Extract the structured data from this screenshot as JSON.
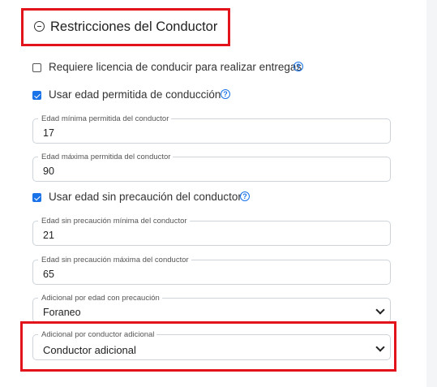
{
  "section": {
    "title": "Restricciones del Conductor"
  },
  "checkboxes": [
    {
      "label": "Requiere licencia de conducir para realizar entregas",
      "checked": false
    },
    {
      "label": "Usar edad permitida de conducción",
      "checked": true
    },
    {
      "label": "Usar edad sin precaución del conductor",
      "checked": true
    }
  ],
  "fields": {
    "min_age": {
      "label": "Edad mínima permitida del conductor",
      "value": "17"
    },
    "max_age": {
      "label": "Edad máxima permitida del conductor",
      "value": "90"
    },
    "min_caution_age": {
      "label": "Edad sin precaución mínima del conductor",
      "value": "21"
    },
    "max_caution_age": {
      "label": "Edad sin precaución máxima del conductor",
      "value": "65"
    }
  },
  "selects": {
    "caution_extra": {
      "label": "Adicional por edad con precaución",
      "value": "Foraneo"
    },
    "additional_driver": {
      "label": "Adicional por conductor adicional",
      "value": "Conductor adicional"
    }
  },
  "icons": {
    "collapse": "minus-circle-icon",
    "help": "question-circle-icon",
    "dropdown": "chevron-down-icon"
  },
  "colors": {
    "highlight": "#e3131b",
    "accent": "#1a73e8"
  }
}
